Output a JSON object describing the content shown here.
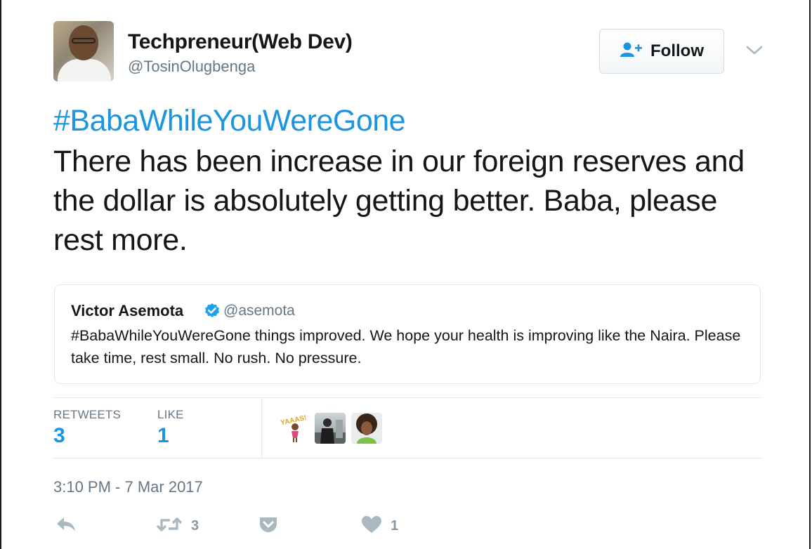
{
  "author": {
    "name": "Techpreneur(Web Dev)",
    "handle": "@TosinOlugbenga"
  },
  "follow_button": {
    "label": "Follow",
    "icon": "person-add-icon"
  },
  "more_menu": {
    "icon": "chevron-down-icon"
  },
  "tweet": {
    "hashtag": "#BabaWhileYouWereGone",
    "text": "There has been increase in our foreign reserves and the dollar is absolutely getting better. Baba, please rest more."
  },
  "quoted_tweet": {
    "name": "Victor Asemota",
    "handle": "@asemota",
    "verified_icon": "verified-badge-icon",
    "text": "#BabaWhileYouWereGone things improved. We hope your health is improving like the Naira. Please take time, rest small. No rush. No pressure."
  },
  "stats": {
    "retweets_label": "RETWEETS",
    "retweets_value": "3",
    "likes_label": "LIKE",
    "likes_value": "1"
  },
  "likers": [
    {
      "name": "liker-avatar-1",
      "caption": "YAAAS!"
    },
    {
      "name": "liker-avatar-2"
    },
    {
      "name": "liker-avatar-3"
    }
  ],
  "timestamp": "3:10 PM - 7 Mar 2017",
  "actions": {
    "reply_icon": "reply-icon",
    "retweet_icon": "retweet-icon",
    "retweet_count": "3",
    "save_icon": "pocket-save-icon",
    "like_icon": "heart-icon",
    "like_count": "1"
  },
  "colors": {
    "link_blue": "#1b95e0",
    "secondary_gray": "#657786",
    "action_gray": "#8899a6",
    "border": "#e1e8ed"
  }
}
